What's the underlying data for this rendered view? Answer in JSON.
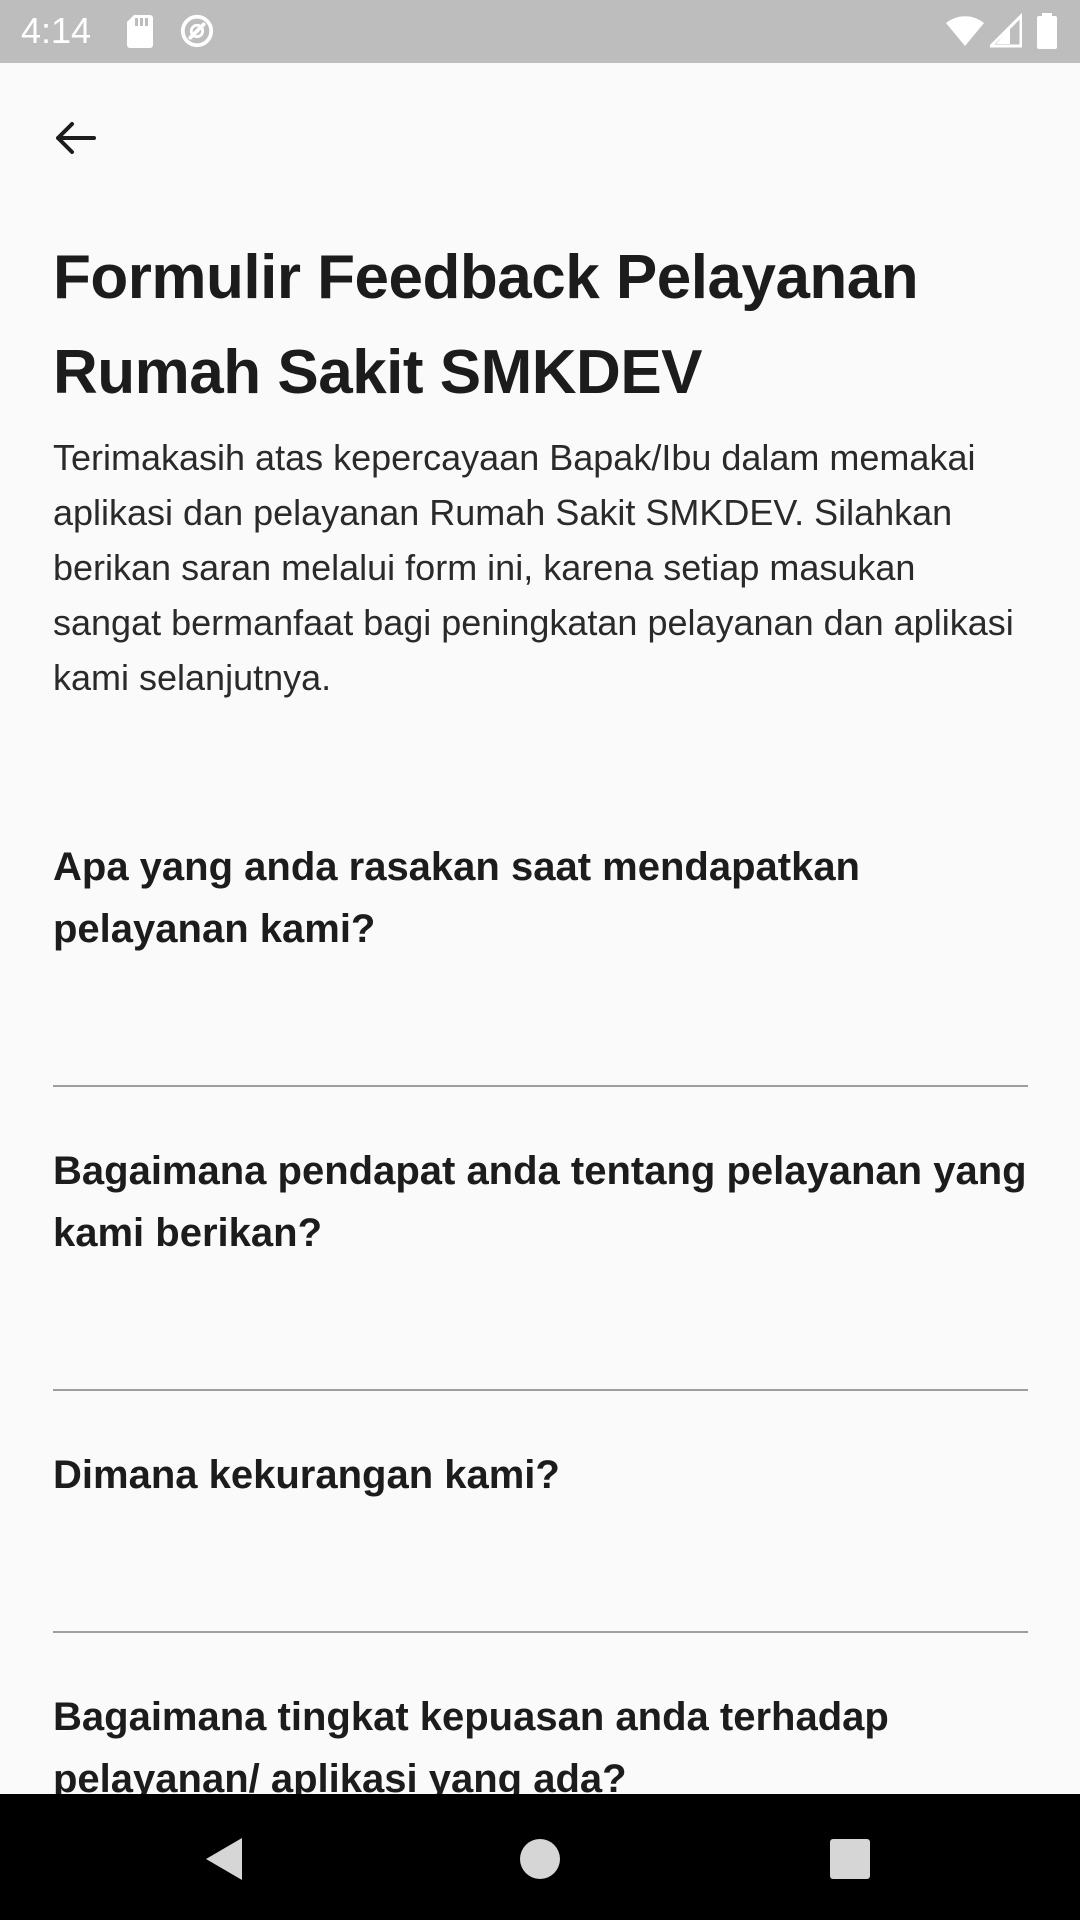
{
  "status_bar": {
    "time": "4:14",
    "icons": [
      "sd-card-icon",
      "do-not-disturb-icon",
      "wifi-icon",
      "signal-icon",
      "battery-icon"
    ]
  },
  "app_bar": {
    "back_icon": "arrow-back-icon"
  },
  "form": {
    "title": "Formulir Feedback Pelayanan Rumah Sakit SMKDEV",
    "description": "Terimakasih atas kepercayaan Bapak/Ibu dalam memakai aplikasi dan pelayanan Rumah Sakit SMKDEV. Silahkan berikan saran melalui form ini, karena setiap masukan sangat bermanfaat bagi peningkatan pelayanan dan aplikasi kami selanjutnya.",
    "questions": [
      {
        "label": "Apa yang anda rasakan saat mendapatkan pelayanan kami?",
        "value": ""
      },
      {
        "label": "Bagaimana pendapat anda tentang pelayanan yang kami berikan?",
        "value": ""
      },
      {
        "label": "Dimana kekurangan kami?",
        "value": ""
      },
      {
        "label": "Bagaimana tingkat kepuasan anda terhadap pelayanan/ aplikasi yang ada?",
        "value": ""
      }
    ]
  },
  "nav_bar": {
    "buttons": [
      "back-triangle-icon",
      "home-circle-icon",
      "recents-square-icon"
    ]
  },
  "colors": {
    "status_bar": "#BDBDBD",
    "background": "#FAFAFA",
    "text_primary": "#1C1C1C",
    "divider": "#9E9E9E",
    "nav_bar": "#000000"
  }
}
